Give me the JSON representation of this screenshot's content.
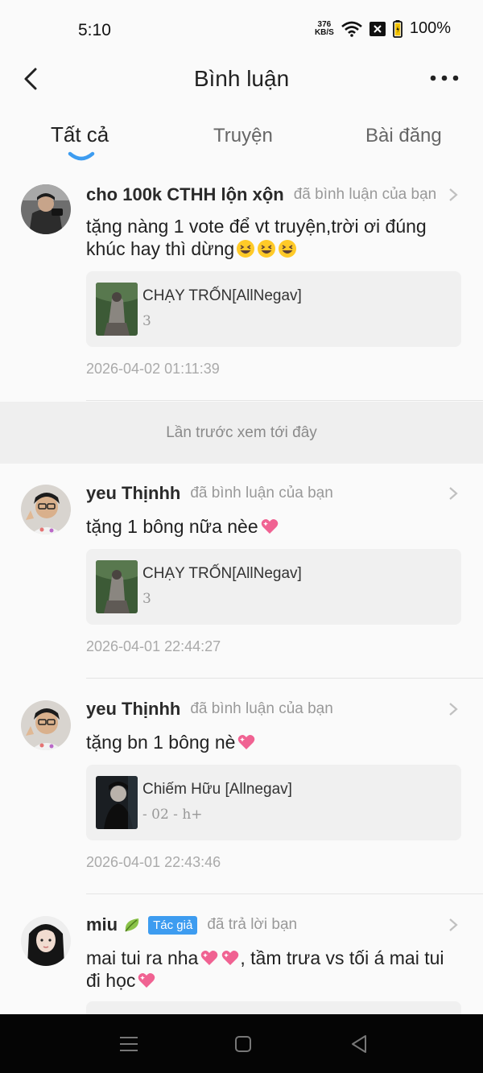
{
  "status_bar": {
    "time": "5:10",
    "net_speed_top": "376",
    "net_speed_bottom": "KB/S",
    "battery": "100%"
  },
  "header": {
    "title": "Bình luận"
  },
  "tabs": [
    {
      "label": "Tất cả",
      "active": true
    },
    {
      "label": "Truyện",
      "active": false
    },
    {
      "label": "Bài đăng",
      "active": false
    }
  ],
  "last_seen_label": "Lần trước xem tới đây",
  "comments": [
    {
      "username": "cho 100k CTHH lộn xộn",
      "action": "đã bình luận của bạn",
      "text": "tặng nàng 1 vote để vt truyện,trời ơi đúng khúc hay thì dừng",
      "emojis": [
        "grin-squint",
        "grin-squint",
        "grin-squint"
      ],
      "card_title": "CHẠY TRỐN[AllNegav]",
      "card_sub": "3",
      "timestamp": "2026-04-02 01:11:39"
    },
    {
      "username": "yeu Thịnhh",
      "action": "đã bình luận của bạn",
      "text": "tặng 1 bông nữa nèe",
      "emojis": [
        "sparkling-heart"
      ],
      "card_title": "CHẠY TRỐN[AllNegav]",
      "card_sub": "3",
      "timestamp": "2026-04-01 22:44:27"
    },
    {
      "username": "yeu Thịnhh",
      "action": "đã bình luận của bạn",
      "text": "tặng bn 1 bông nè",
      "emojis": [
        "sparkling-heart"
      ],
      "card_title": "Chiếm Hữu [Allnegav]",
      "card_sub": "- 02 - h+",
      "timestamp": "2026-04-01 22:43:46"
    },
    {
      "username": "miu",
      "badge": "Tác giả",
      "action": "đã trả lời bạn",
      "text_part1": "mai tui ra nha",
      "text_part2": ", tầm trưa vs tối á mai tui đi học",
      "emojis": [
        "leaf",
        "sparkling-heart",
        "sparkling-heart",
        "sparkling-heart"
      ]
    }
  ],
  "colors": {
    "accent": "#3d9cf0",
    "background": "#fafafa",
    "card": "#f0f0f0",
    "nav_bar": "#050505"
  }
}
